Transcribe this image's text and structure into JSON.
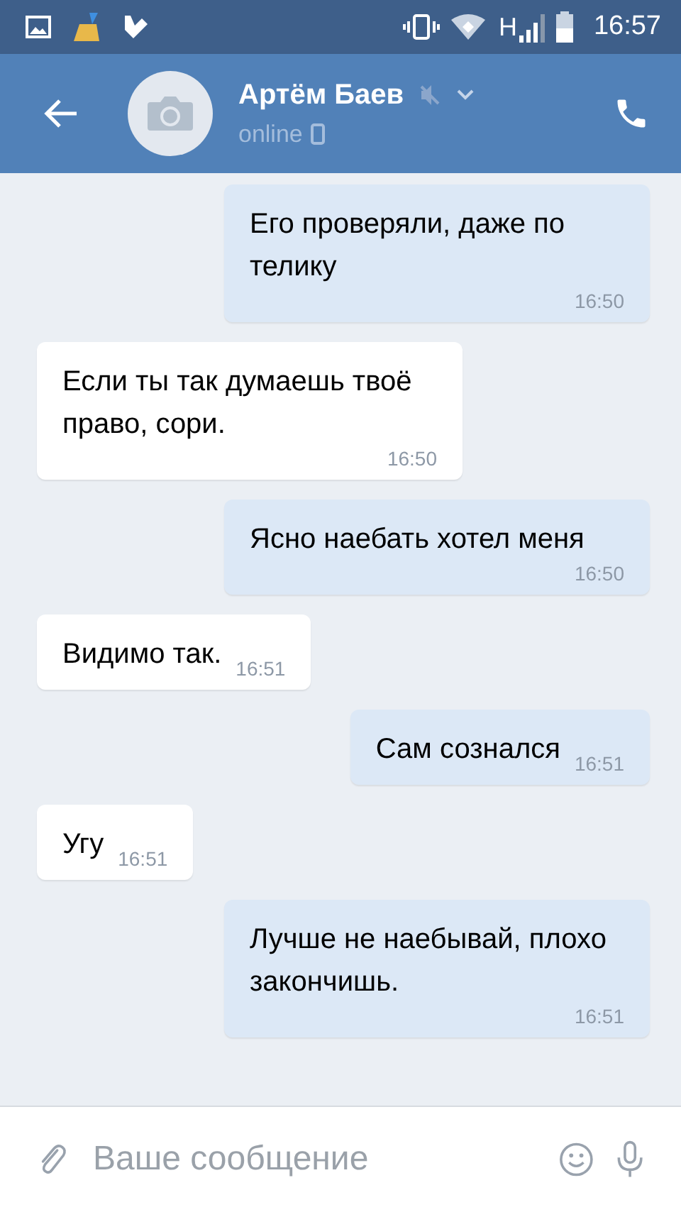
{
  "status_bar": {
    "network": "H",
    "time": "16:57"
  },
  "header": {
    "name": "Артём Баев",
    "muted": true,
    "status": "online"
  },
  "messages": [
    {
      "kind": "outgoing",
      "text": "Его проверяли, даже по телику",
      "time": "16:50"
    },
    {
      "kind": "incoming",
      "text": "Если ты так думаешь твоё право, сори.",
      "time": "16:50"
    },
    {
      "kind": "outgoing",
      "text": "Ясно наебать хотел меня",
      "time": "16:50"
    },
    {
      "kind": "incoming",
      "text": "Видимо так.",
      "time": "16:51"
    },
    {
      "kind": "outgoing",
      "text": "Сам сознался",
      "time": "16:51"
    },
    {
      "kind": "incoming",
      "text": "Угу",
      "time": "16:51"
    },
    {
      "kind": "outgoing",
      "text": "Лучше не наебывай, плохо закончишь.",
      "time": "16:51"
    }
  ],
  "composer": {
    "placeholder": "Ваше сообщение"
  }
}
